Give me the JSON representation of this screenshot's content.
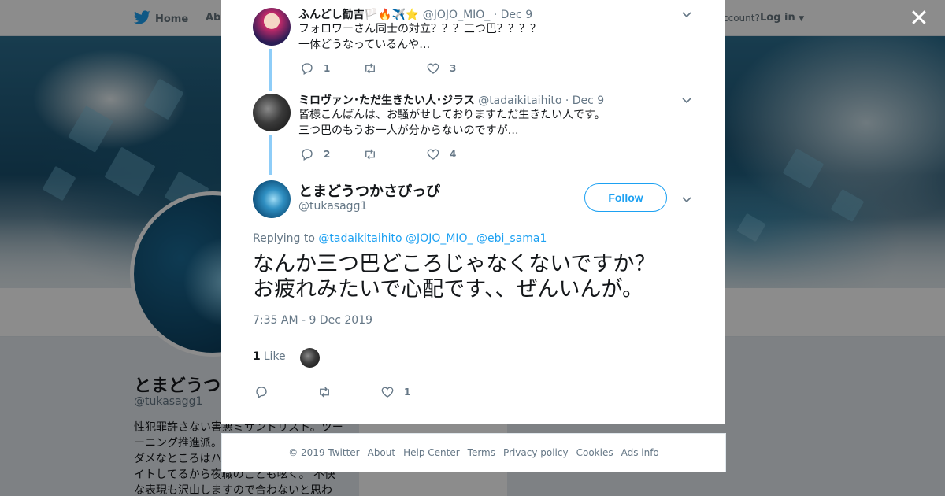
{
  "background": {
    "nav": {
      "home": "Home",
      "about": "Abo",
      "account_prompt": "ccount?",
      "login": "Log in"
    },
    "profile": {
      "name": "とまどうつ",
      "handle": "@tukasagg1",
      "bio": [
        "性犯罪許さない害悪ミサンドリスト。ツー",
        "ーニング推進派。",
        "ダメなところはハ",
        "イトしてるから夜職のことも呟く。 不快",
        "な表現も沢山しますので合わないと思わ"
      ],
      "card_text": "Ads info"
    }
  },
  "modal": {
    "replies": [
      {
        "name": "ふんどし勧吉🏳️🔥✈️⭐",
        "handle": "@JOJO_MIO_",
        "date": "Dec 9",
        "lines": [
          "フォロワーさん同士の対立？？？三つ巴？？？？",
          "一体どうなっているんや…"
        ],
        "reply_count": "1",
        "retweet_count": "",
        "like_count": "3"
      },
      {
        "name": "ミロヴァン･ただ生きたい人･ジラス",
        "handle": "@tadaikitaihito",
        "date": "Dec 9",
        "lines": [
          "皆様こんばんは、お騒がせしておりますただ生きたい人です。",
          "三つ巴のもうお一人が分からないのですが…"
        ],
        "reply_count": "2",
        "retweet_count": "",
        "like_count": "4"
      }
    ],
    "main_tweet": {
      "name": "とまどうつかさぴっぴ",
      "handle": "@tukasagg1",
      "follow_label": "Follow",
      "replying_prefix": "Replying to",
      "replying_to": [
        "@tadaikitaihito",
        "@JOJO_MIO_",
        "@ebi_sama1"
      ],
      "text_lines": [
        "なんか三つ巴どころじゃなくないですか？",
        "お疲れみたいで心配です、、ぜんいんが。"
      ],
      "timestamp": "7:35 AM - 9 Dec 2019",
      "like_stat_count": "1",
      "like_stat_label": "Like",
      "reply_count": "",
      "retweet_count": "",
      "like_count": "1"
    }
  },
  "footer": {
    "copyright": "© 2019 Twitter",
    "links": [
      "About",
      "Help Center",
      "Terms",
      "Privacy policy",
      "Cookies",
      "Ads info"
    ]
  },
  "colors": {
    "accent": "#1da1f2",
    "thread_line": "#8ecdf8",
    "secondary_text": "#657786",
    "overlay": "rgba(0,0,0,0.45)"
  },
  "icons": [
    "twitter-bird-icon",
    "caret-down-icon",
    "close-icon",
    "reply-icon",
    "retweet-icon",
    "heart-icon"
  ]
}
